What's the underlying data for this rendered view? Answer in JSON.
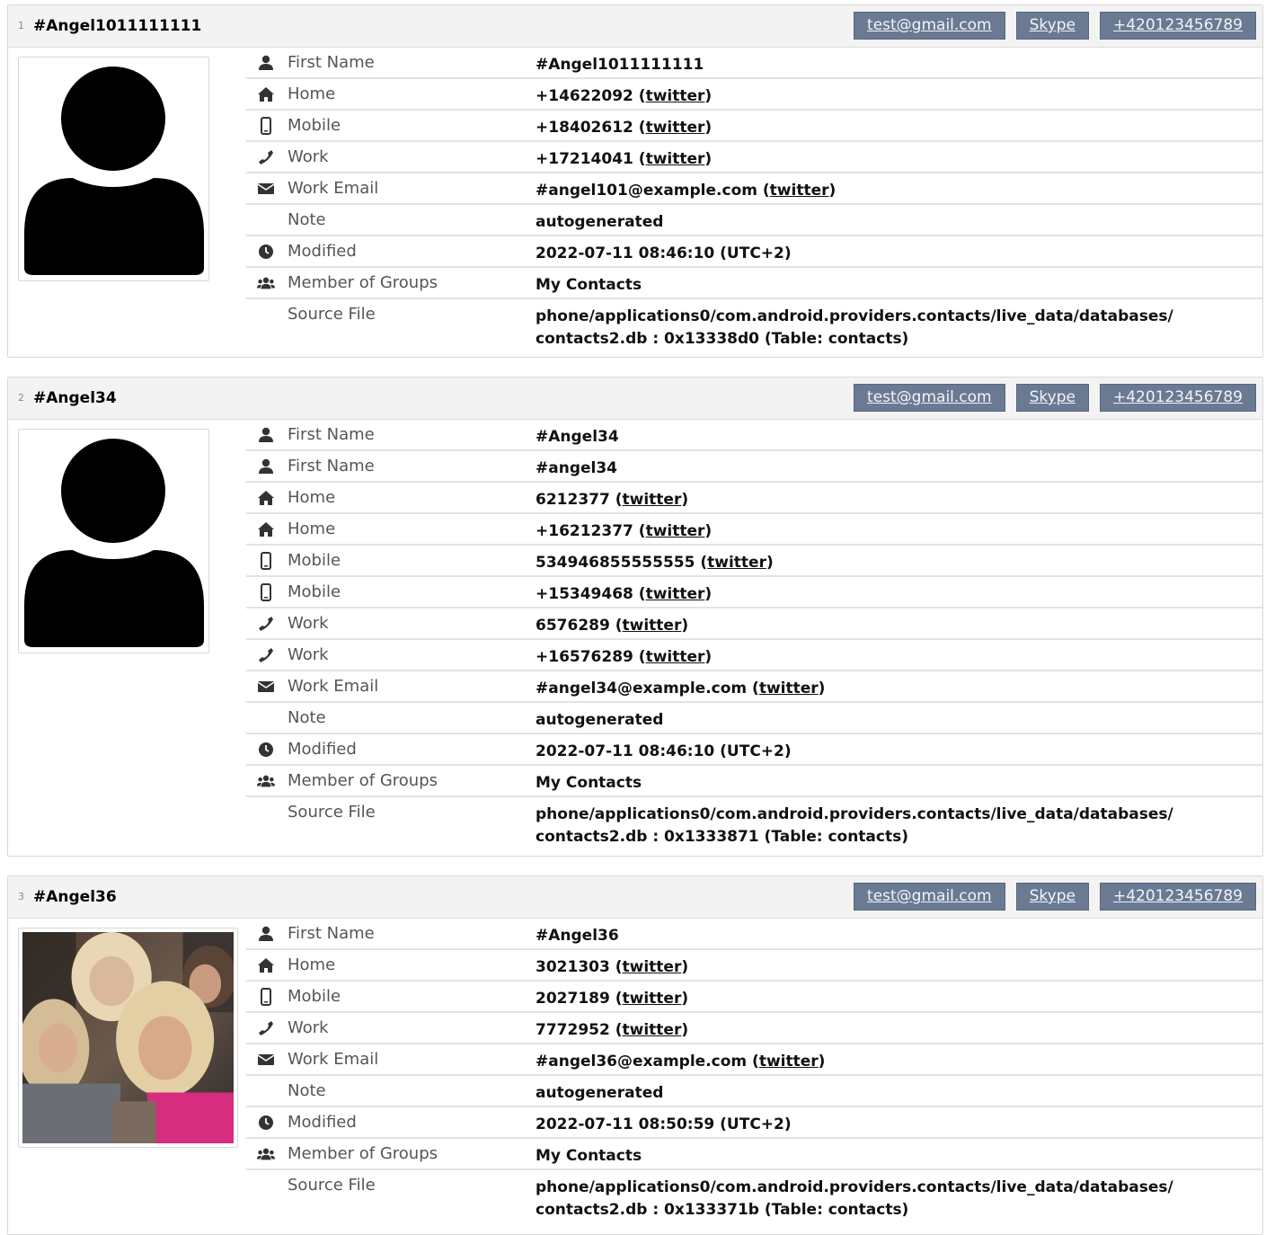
{
  "tags": {
    "email": "test@gmail.com",
    "skype": "Skype",
    "phone": "+420123456789"
  },
  "link_text": "twitter",
  "contacts": [
    {
      "index": "1",
      "name": "#Angel1011111111",
      "avatar": "person-silhouette",
      "rows": [
        {
          "icon": "user-icon",
          "label": "First Name",
          "value": "#Angel1011111111"
        },
        {
          "icon": "home-icon",
          "label": "Home",
          "value": "+14622092",
          "link": "twitter"
        },
        {
          "icon": "mobile-icon",
          "label": "Mobile",
          "value": "+18402612",
          "link": "twitter"
        },
        {
          "icon": "phone-icon",
          "label": "Work",
          "value": "+17214041",
          "link": "twitter"
        },
        {
          "icon": "envelope-icon",
          "label": "Work Email",
          "value": "#angel101@example.com",
          "link": "twitter"
        },
        {
          "icon": "",
          "label": "Note",
          "value": "autogenerated"
        },
        {
          "icon": "clock-icon",
          "label": "Modified",
          "value": "2022-07-11 08:46:10 (UTC+2)"
        },
        {
          "icon": "users-icon",
          "label": "Member of Groups",
          "value": "My Contacts"
        },
        {
          "icon": "",
          "label": "Source File",
          "value_line1": "phone/applications0/com.android.providers.contacts/live_data/databases/",
          "value_line2": "contacts2.db : 0x13338d0 (Table: contacts)"
        }
      ]
    },
    {
      "index": "2",
      "name": "#Angel34",
      "avatar": "person-silhouette",
      "rows": [
        {
          "icon": "user-icon",
          "label": "First Name",
          "value": "#Angel34"
        },
        {
          "icon": "user-icon",
          "label": "First Name",
          "value": "#angel34"
        },
        {
          "icon": "home-icon",
          "label": "Home",
          "value": "6212377",
          "link": "twitter"
        },
        {
          "icon": "home-icon",
          "label": "Home",
          "value": "+16212377",
          "link": "twitter"
        },
        {
          "icon": "mobile-icon",
          "label": "Mobile",
          "value": "534946855555555",
          "link": "twitter"
        },
        {
          "icon": "mobile-icon",
          "label": "Mobile",
          "value": "+15349468",
          "link": "twitter"
        },
        {
          "icon": "phone-icon",
          "label": "Work",
          "value": "6576289",
          "link": "twitter"
        },
        {
          "icon": "phone-icon",
          "label": "Work",
          "value": "+16576289",
          "link": "twitter"
        },
        {
          "icon": "envelope-icon",
          "label": "Work Email",
          "value": "#angel34@example.com",
          "link": "twitter"
        },
        {
          "icon": "",
          "label": "Note",
          "value": "autogenerated"
        },
        {
          "icon": "clock-icon",
          "label": "Modified",
          "value": "2022-07-11 08:46:10 (UTC+2)"
        },
        {
          "icon": "users-icon",
          "label": "Member of Groups",
          "value": "My Contacts"
        },
        {
          "icon": "",
          "label": "Source File",
          "value_line1": "phone/applications0/com.android.providers.contacts/live_data/databases/",
          "value_line2": "contacts2.db : 0x1333871 (Table: contacts)"
        }
      ]
    },
    {
      "index": "3",
      "name": "#Angel36",
      "avatar": "photo",
      "rows": [
        {
          "icon": "user-icon",
          "label": "First Name",
          "value": "#Angel36"
        },
        {
          "icon": "home-icon",
          "label": "Home",
          "value": "3021303",
          "link": "twitter"
        },
        {
          "icon": "mobile-icon",
          "label": "Mobile",
          "value": "2027189",
          "link": "twitter"
        },
        {
          "icon": "phone-icon",
          "label": "Work",
          "value": "7772952",
          "link": "twitter"
        },
        {
          "icon": "envelope-icon",
          "label": "Work Email",
          "value": "#angel36@example.com",
          "link": "twitter"
        },
        {
          "icon": "",
          "label": "Note",
          "value": "autogenerated"
        },
        {
          "icon": "clock-icon",
          "label": "Modified",
          "value": "2022-07-11 08:50:59 (UTC+2)"
        },
        {
          "icon": "users-icon",
          "label": "Member of Groups",
          "value": "My Contacts"
        },
        {
          "icon": "",
          "label": "Source File",
          "value_line1": "phone/applications0/com.android.providers.contacts/live_data/databases/",
          "value_line2": "contacts2.db : 0x133371b (Table: contacts)"
        }
      ]
    }
  ]
}
